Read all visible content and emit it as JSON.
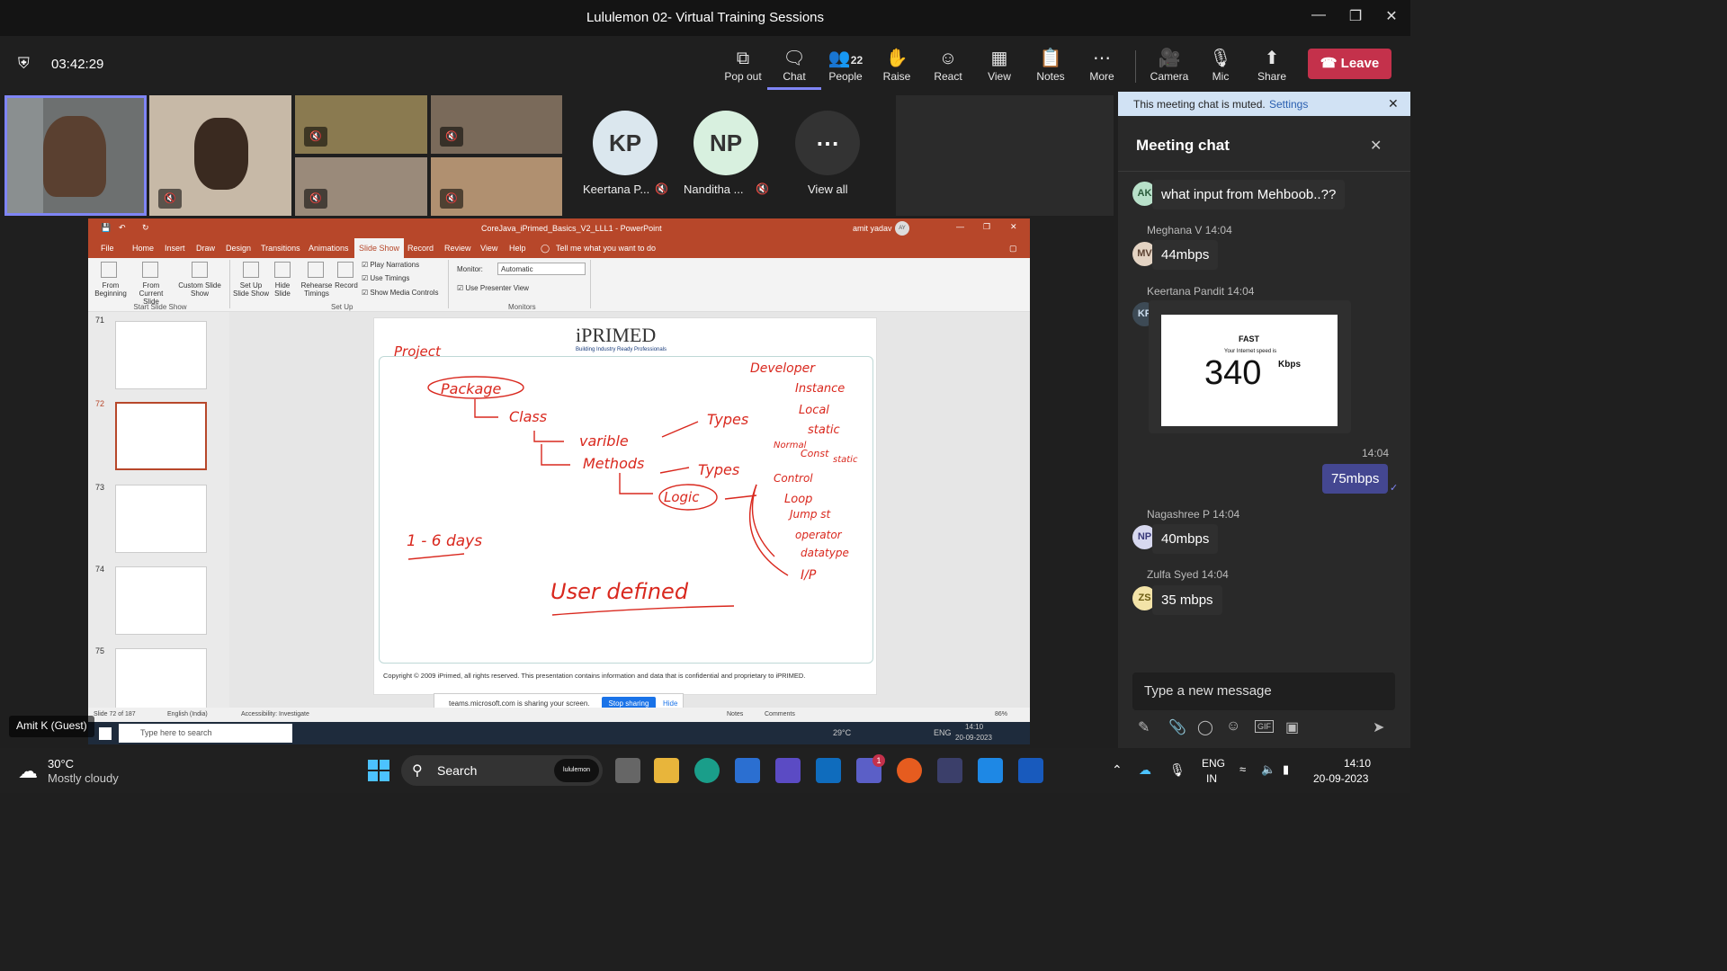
{
  "window": {
    "title": "Lululemon 02- Virtual Training Sessions"
  },
  "meeting": {
    "timer": "03:42:29",
    "people_count": "22"
  },
  "toolbar": {
    "popout": "Pop out",
    "chat": "Chat",
    "people": "People",
    "raise": "Raise",
    "react": "React",
    "view": "View",
    "notes": "Notes",
    "more": "More",
    "camera": "Camera",
    "mic": "Mic",
    "share": "Share",
    "leave": "Leave"
  },
  "participants": {
    "kp_initials": "KP",
    "kp_name": "Keertana P...",
    "np_initials": "NP",
    "np_name": "Nanditha ...",
    "view_all": "View all",
    "self_label": "Amit K (Guest)"
  },
  "ppt": {
    "doc_title": "CoreJava_iPrimed_Basics_V2_LLL1 - PowerPoint",
    "user": "amit yadav",
    "user_initials": "AY",
    "menu": [
      "File",
      "Home",
      "Insert",
      "Draw",
      "Design",
      "Transitions",
      "Animations",
      "Slide Show",
      "Record",
      "Review",
      "View",
      "Help"
    ],
    "tell_me": "Tell me what you want to do",
    "ribbon": {
      "from_beginning": "From Beginning",
      "from_current": "From Current Slide",
      "custom": "Custom Slide Show",
      "group1": "Start Slide Show",
      "setup": "Set Up Slide Show",
      "hide": "Hide Slide",
      "rehearse": "Rehearse Timings",
      "record": "Record",
      "play_narr": "Play Narrations",
      "use_timings": "Use Timings",
      "show_media": "Show Media Controls",
      "group2": "Set Up",
      "monitor_label": "Monitor:",
      "monitor_val": "Automatic",
      "presenter": "Use Presenter View",
      "group3": "Monitors"
    },
    "thumbs": [
      "71",
      "72",
      "73",
      "74",
      "75"
    ],
    "logo": "iPRIMED",
    "logo_tag": "Building Industry Ready Professionals",
    "footer": "Copyright © 2009 iPrimed, all rights reserved. This presentation contains information and data that is confidential and proprietary to iPRIMED.",
    "sharing": "teams.microsoft.com is sharing your screen.",
    "stop_sharing": "Stop sharing",
    "hide": "Hide",
    "status_slide": "Slide 72 of 187",
    "status_lang": "English (India)",
    "status_access": "Accessibility: Investigate",
    "status_notes": "Notes",
    "status_comments": "Comments",
    "status_zoom": "86%",
    "inner_search": "Type here to search",
    "inner_temp": "29°C",
    "inner_lang": "ENG",
    "inner_time": "14:10",
    "inner_date": "20-09-2023"
  },
  "handwriting": {
    "project": "Project",
    "package": "Package",
    "class": "Class",
    "variable": "varible",
    "methods": "Methods",
    "types1": "Types",
    "types2": "Types",
    "developer": "Developer",
    "instance": "Instance",
    "local": "Local",
    "static1": "static",
    "normal": "Normal",
    "const": "Const",
    "static2": "static",
    "control": "Control",
    "logic": "Logic",
    "loop": "Loop",
    "jump": "Jump st",
    "operator": "operator",
    "datatype": "datatype",
    "io": "I/P",
    "days": "1 - 6 days",
    "user_defined": "User defined"
  },
  "chat": {
    "muted_notice": "This meeting chat is muted.",
    "settings": "Settings",
    "header": "Meeting chat",
    "m1_initials": "AK",
    "m1_text": "what input from Mehboob..??",
    "m2_name": "Meghana V",
    "m2_time": "14:04",
    "m2_initials": "MV",
    "m2_text": "44mbps",
    "m3_name": "Keertana Pandit",
    "m3_time": "14:04",
    "m3_initials": "KP",
    "speed_brand": "FAST",
    "speed_caption": "Your Internet speed is",
    "speed_value": "340",
    "speed_unit": "Kbps",
    "m4_time": "14:04",
    "m4_text": "75mbps",
    "m5_name": "Nagashree P",
    "m5_time": "14:04",
    "m5_initials": "NP",
    "m5_text": "40mbps",
    "m6_name": "Zulfa Syed",
    "m6_time": "14:04",
    "m6_initials": "ZS",
    "m6_text": "35 mbps",
    "input_placeholder": "Type a new message"
  },
  "taskbar": {
    "temp": "30°C",
    "weather": "Mostly cloudy",
    "search": "Search",
    "pill": "lululemon",
    "lang1": "ENG",
    "lang2": "IN",
    "time": "14:10",
    "date": "20-09-2023",
    "teams_badge": "1"
  },
  "colors": {
    "leave": "#c4314b",
    "ppt_accent": "#b7472a",
    "ink": "#d9281e",
    "accent": "#7f85f5"
  }
}
